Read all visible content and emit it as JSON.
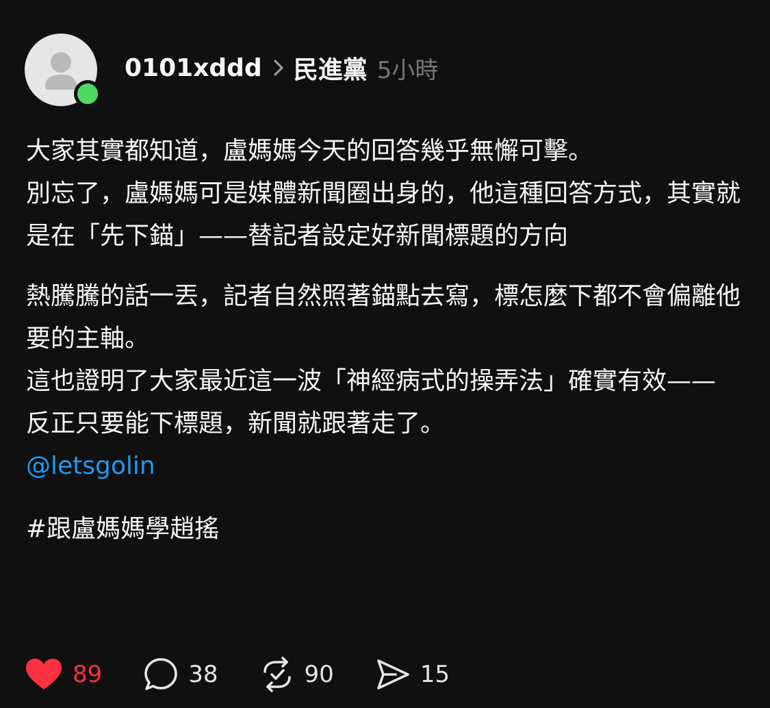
{
  "post": {
    "username": "0101xddd",
    "community": "民進黨",
    "timestamp": "5小時",
    "paragraphs": [
      "大家其實都知道，盧媽媽今天的回答幾乎無懈可擊。",
      "別忘了，盧媽媽可是媒體新聞圈出身的，他這種回答方式，其實就是在「先下錨」——替記者設定好新聞標題的方向",
      "熱騰騰的話一丟，記者自然照著錨點去寫，標怎麼下都不會偏離他要的主軸。",
      "這也證明了大家最近這一波「神經病式的操弄法」確實有效——",
      "反正只要能下標題，新聞就跟著走了。"
    ],
    "mention": "@letsgolin",
    "hashtag": "#跟盧媽媽學趙搖"
  },
  "actions": {
    "likes": "89",
    "comments": "38",
    "reposts": "90",
    "shares": "15"
  },
  "colors": {
    "background": "#101010",
    "liked": "#ff3040",
    "mention": "#1d9bf0",
    "online": "#4cd964"
  },
  "icons": {
    "avatar": "default-user-avatar",
    "online": "online-status-dot",
    "chevron": "chevron-right-icon",
    "like": "heart-icon",
    "comment": "comment-bubble-icon",
    "repost": "repost-icon",
    "share": "share-send-icon"
  }
}
